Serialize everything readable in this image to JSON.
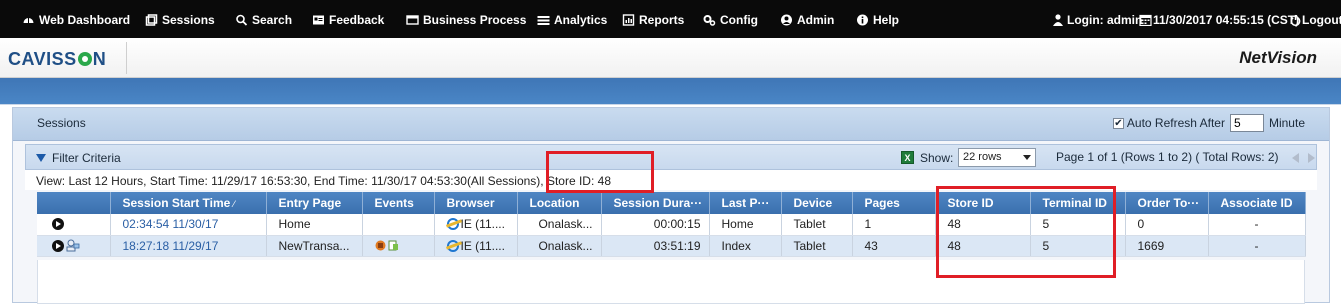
{
  "nav": {
    "items": [
      {
        "label": "Web Dashboard",
        "icon": "dashboard-icon"
      },
      {
        "label": "Sessions",
        "icon": "sessions-icon"
      },
      {
        "label": "Search",
        "icon": "search-icon"
      },
      {
        "label": "Feedback",
        "icon": "feedback-icon"
      },
      {
        "label": "Business Process",
        "icon": "business-process-icon"
      },
      {
        "label": "Analytics",
        "icon": "analytics-icon"
      },
      {
        "label": "Reports",
        "icon": "reports-icon"
      },
      {
        "label": "Config",
        "icon": "config-icon"
      },
      {
        "label": "Admin",
        "icon": "admin-icon"
      },
      {
        "label": "Help",
        "icon": "help-icon"
      }
    ],
    "login": "Login: admin",
    "datetime": "11/30/2017 04:55:15 (CST)",
    "logout": "Logout"
  },
  "brand": {
    "logo_pre": "CAVISS",
    "logo_post": "N",
    "product": "NetVision"
  },
  "panel": {
    "title": "Sessions",
    "auto_refresh_label": "Auto Refresh After",
    "auto_refresh_checked": true,
    "auto_refresh_value": "5",
    "auto_refresh_unit": "Minute"
  },
  "filter": {
    "label": "Filter Criteria",
    "show_label": "Show:",
    "rows_selected": "22 rows",
    "page_info": "Page 1 of 1 (Rows 1 to 2) ( Total Rows: 2)",
    "view_text": "View: Last 12 Hours, Start Time: 11/29/17 16:53:30, End Time: 11/30/17 04:53:30(All Sessions), Store ID: 48"
  },
  "table": {
    "headers": [
      "",
      "Session Start Time",
      "Entry Page",
      "Events",
      "Browser",
      "Location",
      "Session Dura···",
      "Last P···",
      "Device",
      "Pages",
      "Store ID",
      "Terminal ID",
      "Order To···",
      "Associate ID"
    ],
    "rows": [
      {
        "start": "02:34:54 11/30/17",
        "entry": "Home",
        "browser": "IE (11....",
        "location": "Onalask...",
        "duration": "00:00:15",
        "last_page": "Home",
        "device": "Tablet",
        "pages": "1",
        "store_id": "48",
        "terminal_id": "5",
        "order_total": "0",
        "associate_id": "-"
      },
      {
        "start": "18:27:18 11/29/17",
        "entry": "NewTransa...",
        "browser": "IE (11....",
        "location": "Onalask...",
        "duration": "03:51:19",
        "last_page": "Index",
        "device": "Tablet",
        "pages": "43",
        "store_id": "48",
        "terminal_id": "5",
        "order_total": "1669",
        "associate_id": "-"
      }
    ]
  },
  "colors": {
    "nav_bg": "#0a0a0a",
    "accent_blue": "#3f76b6",
    "header_blue": "#4f86c4",
    "highlight_red": "#e01e26"
  }
}
